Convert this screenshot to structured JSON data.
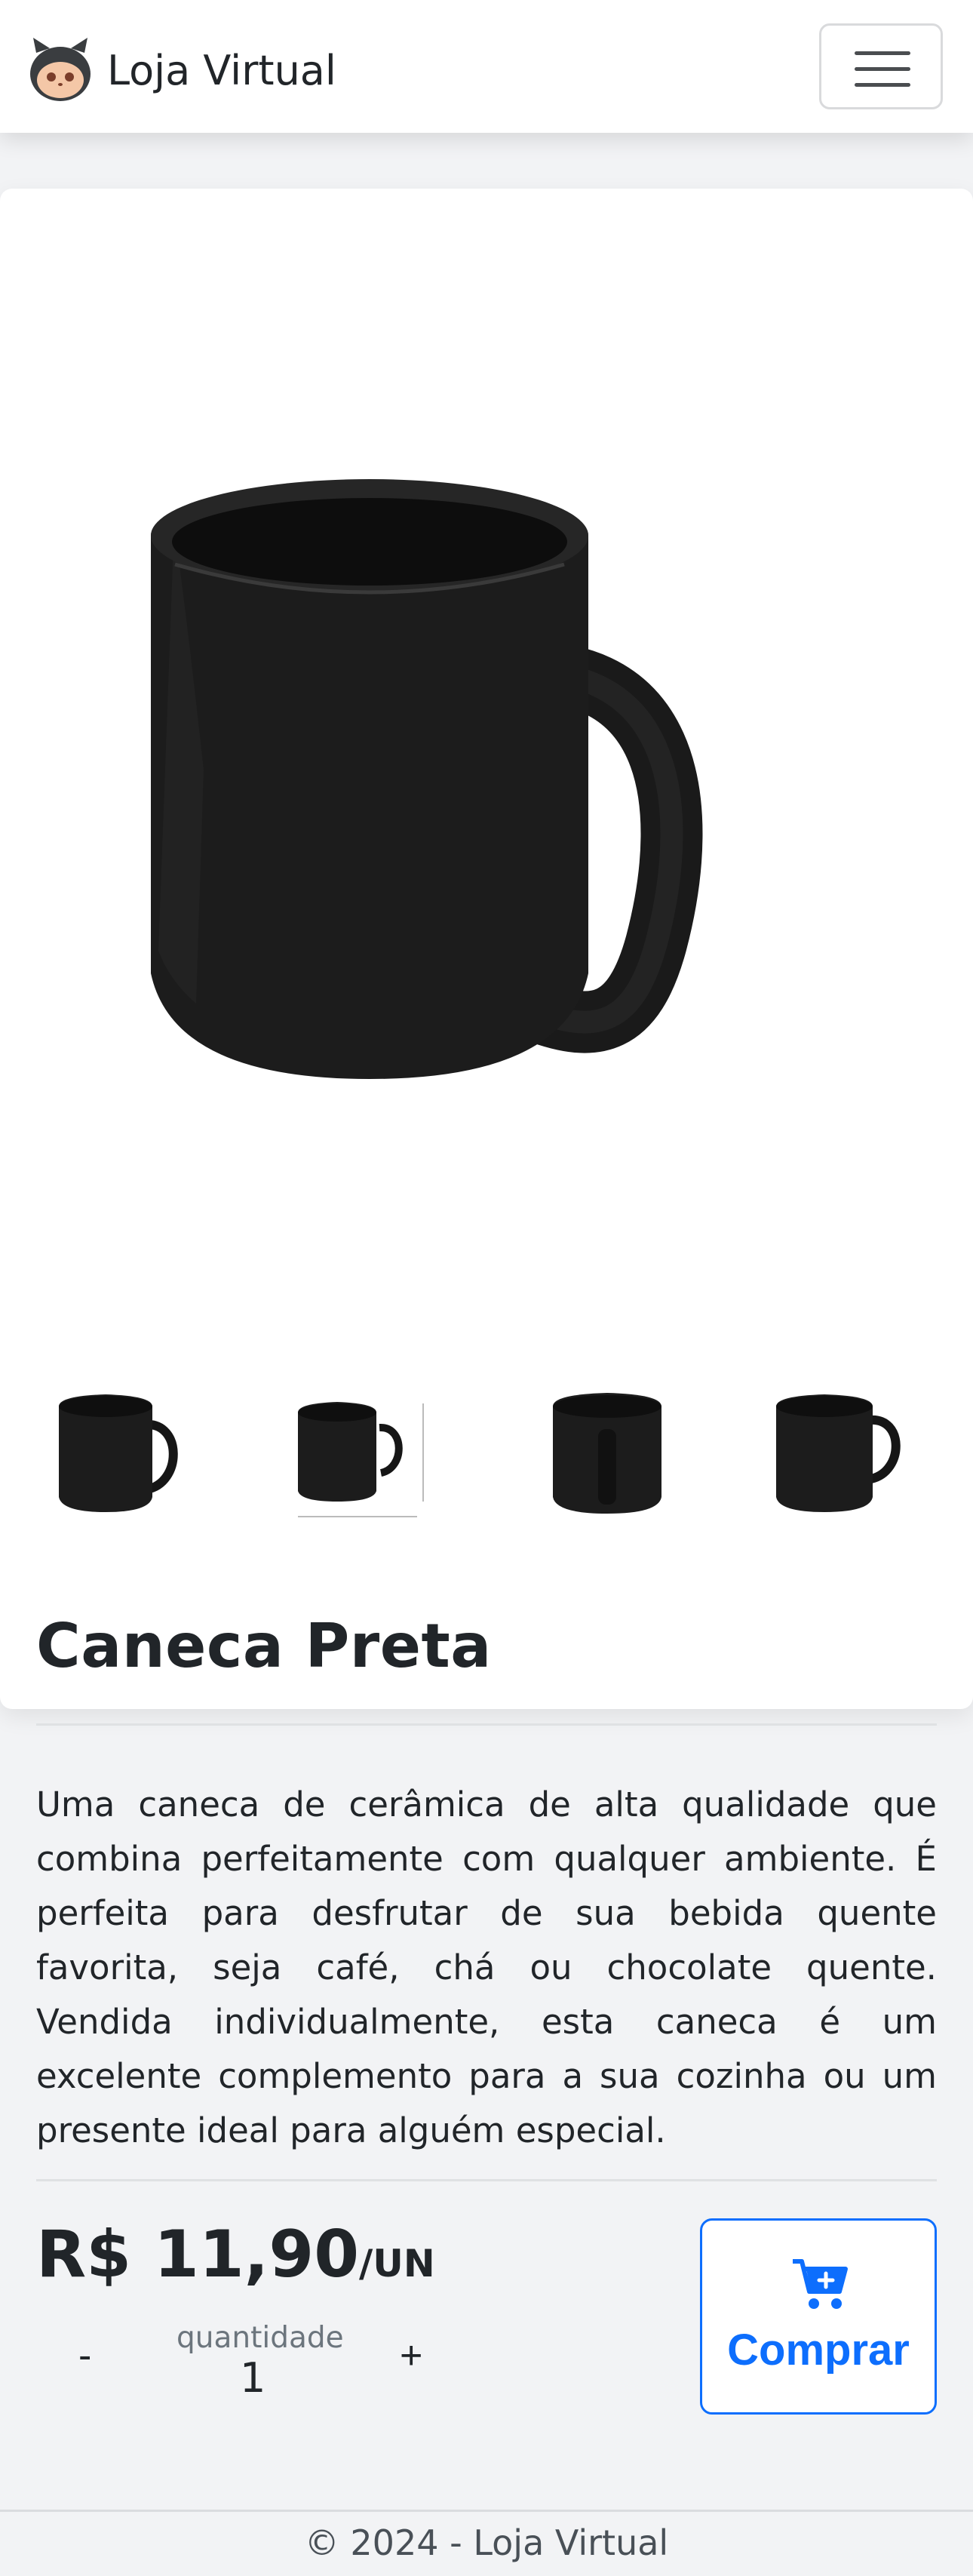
{
  "navbar": {
    "brand": "Loja Virtual",
    "logo_icon": "octocat-icon",
    "menu_icon": "hamburger-icon"
  },
  "product": {
    "title": "Caneca Preta",
    "description": "Uma caneca de cerâmica de alta qualidade que combina perfeitamente com qualquer ambiente. É perfeita para desfrutar de sua bebida quente favorita, seja café, chá ou chocolate quente. Vendida individualmente, esta caneca é um excelente complemento para a sua cozinha ou um presente ideal para alguém especial.",
    "price": "R$ 11,90",
    "unit": "/UN",
    "quantity_label": "quantidade",
    "quantity": "1",
    "minus_label": "-",
    "plus_label": "+",
    "buy_label": "Comprar",
    "buy_icon": "cart-plus-icon",
    "image_count": 4
  },
  "colors": {
    "accent": "#0d6efd",
    "text": "#212529",
    "muted": "#6c757d",
    "page_bg": "#f2f3f5"
  },
  "footer": {
    "text": "© 2024 - Loja Virtual"
  }
}
